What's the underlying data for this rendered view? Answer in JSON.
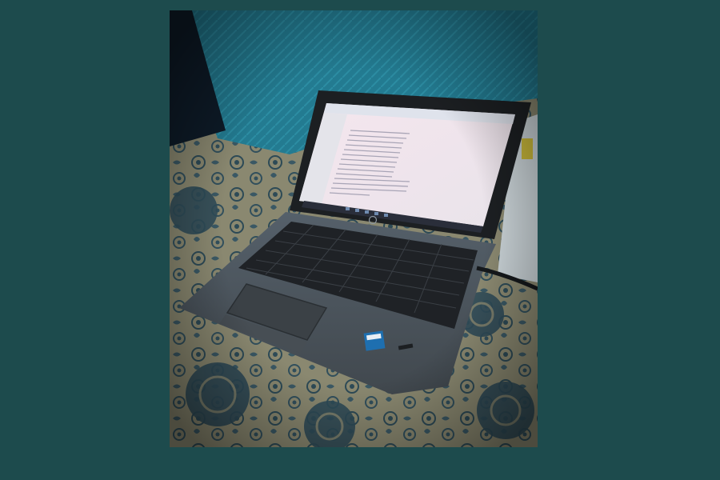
{
  "page": {
    "background_color": "#1d4b4d"
  },
  "photo": {
    "subject": "laptop-on-bed",
    "colors": {
      "pillow": "#237b91",
      "bedsheet": "#8a8870",
      "bedsheet_pattern": "#314f5c",
      "laptop_body": "#4d5459",
      "screen_bezel": "#1c1f22",
      "screen_glow": "#f1e5ec",
      "keyboard": "#1f2226",
      "intel_sticker": "#1e6fb0"
    },
    "screen": {
      "app": "file-explorer",
      "file_rows": 14
    }
  }
}
